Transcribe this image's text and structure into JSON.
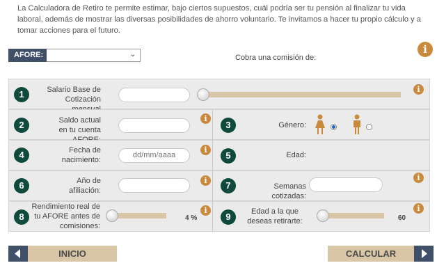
{
  "intro": "La Calculadora de Retiro te permite estimar, bajo ciertos supuestos, cuál podría ser tu pensión al finalizar tu vida laboral, además de mostrar las diversas posibilidades de ahorro voluntario. Te invitamos a hacer tu propio cálculo y a tomar acciones para el futuro.",
  "afore": {
    "label": "AFORE:",
    "selected": ""
  },
  "commission_label": "Cobra una comisión de:",
  "fields": {
    "f1": {
      "num": "1",
      "label_l1": "Salario Base de",
      "label_l2": "Cotización mensual",
      "value": ""
    },
    "f2": {
      "num": "2",
      "label_l1": "Saldo actual",
      "label_l2": "en tu cuenta AFORE:",
      "value": ""
    },
    "f3": {
      "num": "3",
      "label": "Género:",
      "selected": "female"
    },
    "f4": {
      "num": "4",
      "label_l1": "Fecha de",
      "label_l2": "nacimiento:",
      "placeholder": "dd/mm/aaaa"
    },
    "f5": {
      "num": "5",
      "label": "Edad:"
    },
    "f6": {
      "num": "6",
      "label_l1": "Año de",
      "label_l2": "afiliación:",
      "value": ""
    },
    "f7": {
      "num": "7",
      "label": "Semanas cotizadas:",
      "value": ""
    },
    "f8": {
      "num": "8",
      "label_l1": "Rendimiento real de",
      "label_l2": "tu AFORE antes de",
      "label_l3": "comisiones:",
      "value_text": "4 %",
      "level": 0
    },
    "f9": {
      "num": "9",
      "label_l1": "Edad a la que",
      "label_l2": "deseas retirarte:",
      "value_text": "60",
      "level": 0
    }
  },
  "buttons": {
    "back": "INICIO",
    "next": "CALCULAR"
  },
  "colors": {
    "brand_dark": "#3f5068",
    "accent_tan": "#d8c6a6",
    "number_badge": "#0f4a3c",
    "info": "#c98a3e"
  }
}
